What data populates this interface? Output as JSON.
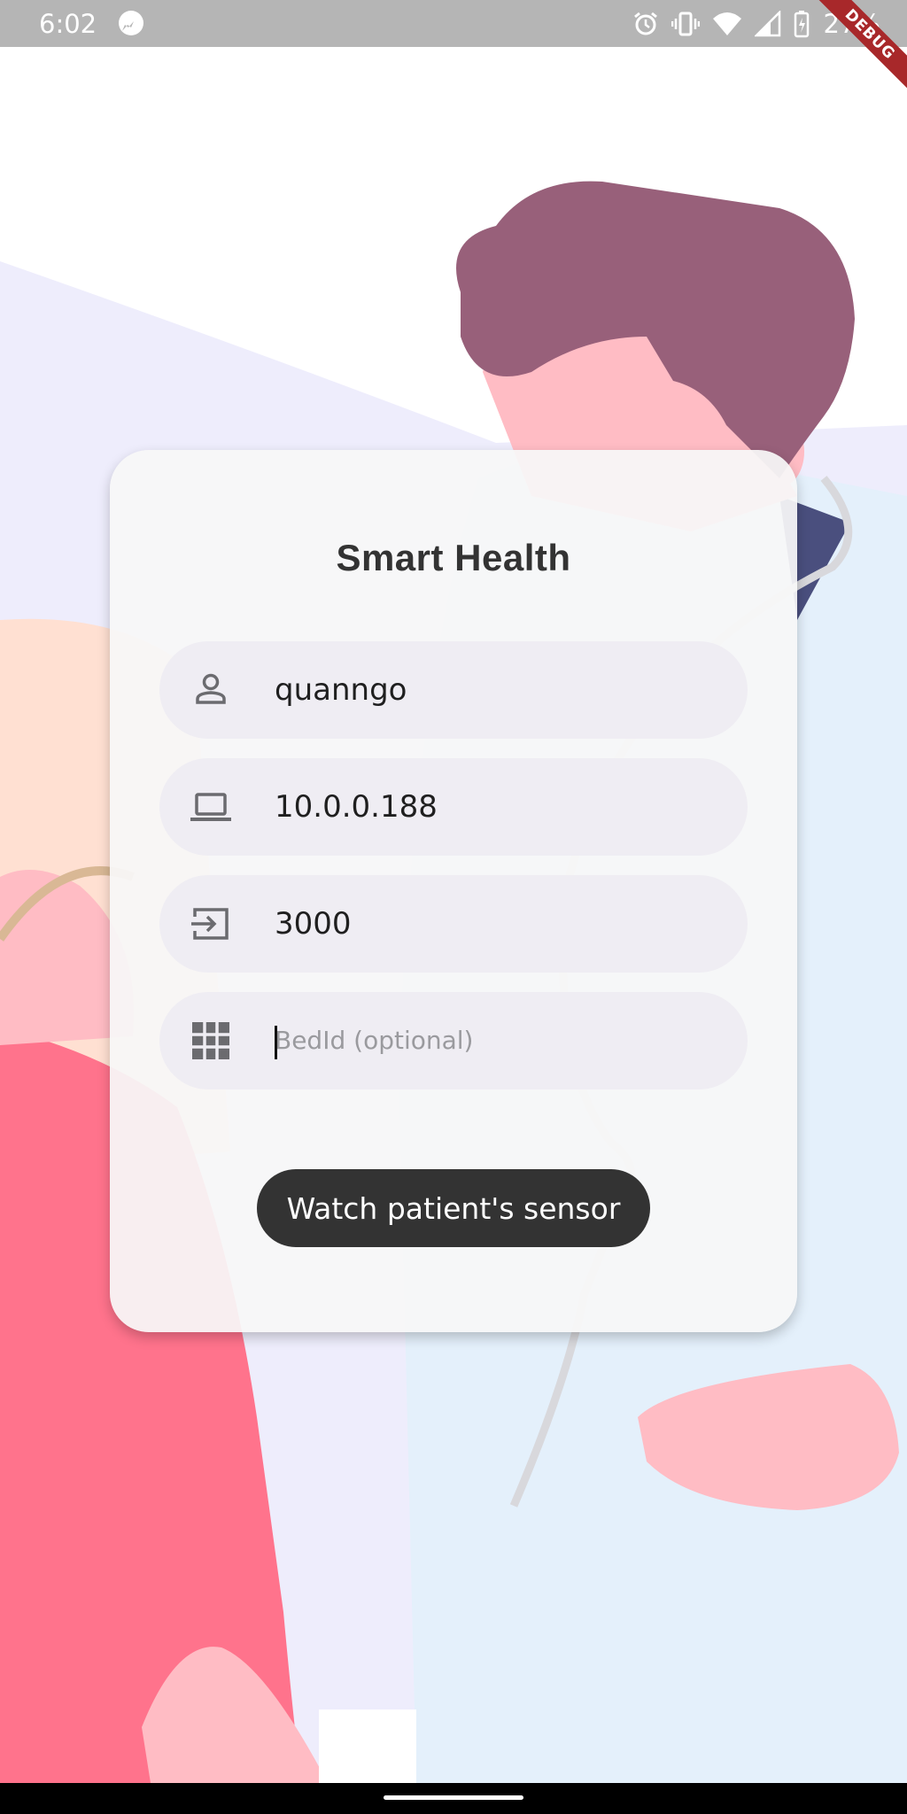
{
  "status_bar": {
    "time": "6:02",
    "battery_percent": "27%",
    "debug_banner": "DEBUG",
    "icons": [
      "messenger-icon",
      "alarm-icon",
      "vibrate-icon",
      "wifi-icon",
      "signal-icon",
      "battery-icon"
    ]
  },
  "card": {
    "title": "Smart Health",
    "fields": [
      {
        "icon": "person-icon",
        "value": "quanngo"
      },
      {
        "icon": "laptop-icon",
        "value": "10.0.0.188"
      },
      {
        "icon": "input-icon",
        "value": "3000"
      },
      {
        "icon": "grid-icon",
        "value": "",
        "placeholder": "BedId (optional)"
      }
    ],
    "button_label": "Watch patient's sensor"
  },
  "colors": {
    "card_background": "#f8f8f8",
    "field_background": "#efedf3",
    "button_background": "#333333",
    "status_bar": "#b5b5b5",
    "hair": "#98607a",
    "skin": "#ffbcc4",
    "shirt_red": "#ff738c",
    "coat_blue": "#e4f0fb",
    "lavender_bg": "#eeedfc",
    "peach_bg": "#ffe0d2"
  }
}
